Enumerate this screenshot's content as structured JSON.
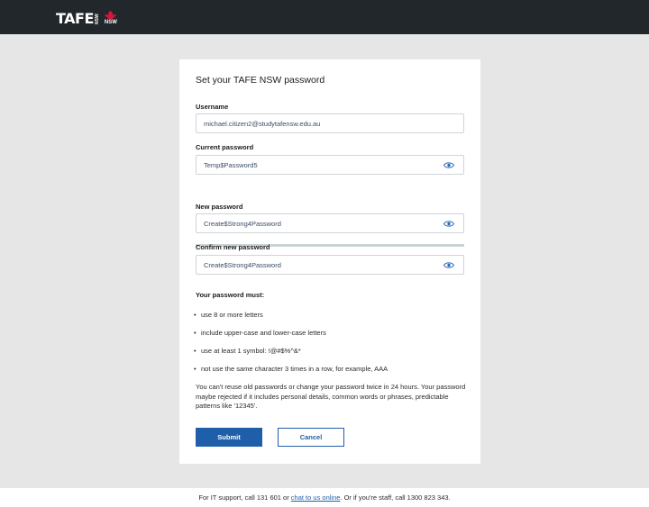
{
  "header": {
    "logo_text": "TAFE",
    "logo_sub": "NSW",
    "waratah_label": "NSW"
  },
  "form": {
    "title": "Set your TAFE NSW password",
    "username_label": "Username",
    "username_value": "michael.citizen2@studytafensw.edu.au",
    "current_password_label": "Current password",
    "current_password_value": "Temp$Password5",
    "new_password_label": "New password",
    "new_password_value": "Create$Strong4Password",
    "confirm_password_label": "Confirm new password",
    "confirm_password_value": "Create$Strong4Password"
  },
  "rules": {
    "title": "Your password must:",
    "items": [
      "use 8 or more letters",
      "include upper-case and lower-case letters",
      "use at least 1 symbol: !@#$%^&*",
      "not use the same character 3 times in a row, for example, AAA"
    ],
    "note": "You can't reuse old passwords or change your password twice in 24 hours. Your password maybe rejected if it includes personal details, common words or phrases, predictable patterns like '12345'."
  },
  "buttons": {
    "submit_label": "Submit",
    "cancel_label": "Cancel"
  },
  "footer": {
    "text_before": "For IT support, call 131 601 or ",
    "link_text": "chat to us online",
    "text_after": ". Or if you're staff, call 1300 823 343."
  },
  "colors": {
    "header_bg": "#22272b",
    "primary_button": "#1f5fa9",
    "accent_red": "#d7153a",
    "eye_icon": "#2e6db4"
  }
}
